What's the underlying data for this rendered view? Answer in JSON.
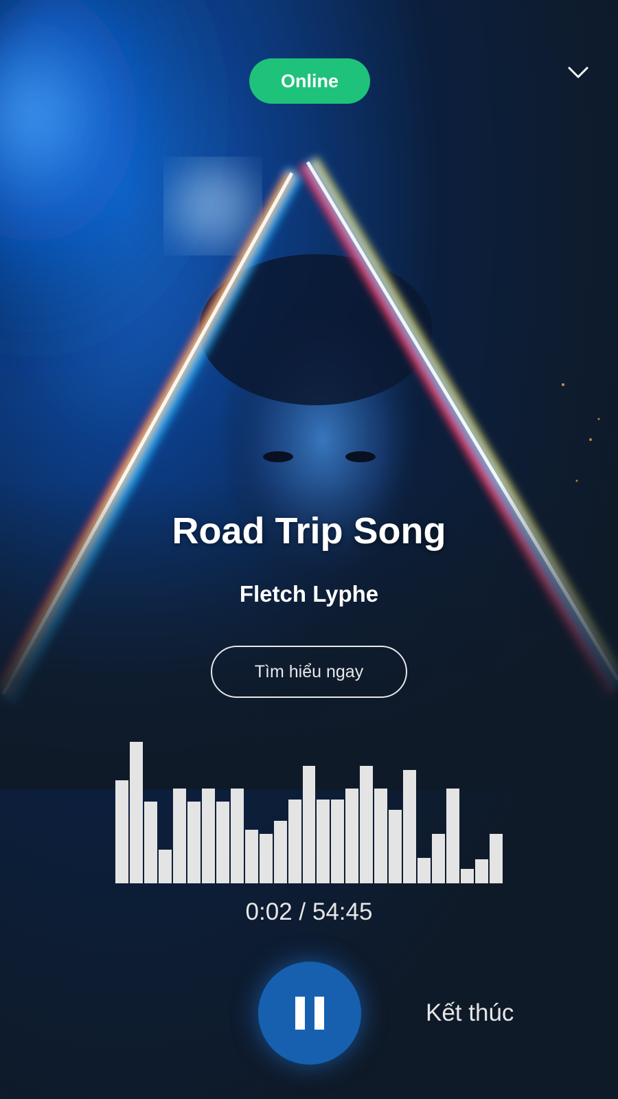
{
  "header": {
    "status_label": "Online",
    "collapse_icon": "chevron-down-icon"
  },
  "track": {
    "title": "Road Trip Song",
    "artist": "Fletch Lyphe",
    "learn_more_label": "Tìm hiểu ngay"
  },
  "player": {
    "current_time": "0:02",
    "total_time": "54:45",
    "time_separator": " / ",
    "pause_icon": "pause-icon",
    "end_label": "Kết thúc",
    "visualizer_levels": [
      0.73,
      1.0,
      0.58,
      0.24,
      0.67,
      0.58,
      0.67,
      0.58,
      0.67,
      0.38,
      0.35,
      0.44,
      0.59,
      0.83,
      0.59,
      0.59,
      0.67,
      0.83,
      0.67,
      0.52,
      0.8,
      0.18,
      0.35,
      0.67,
      0.1,
      0.17,
      0.35
    ]
  },
  "colors": {
    "status_green": "#1ec27a",
    "play_button_blue": "#1760b0",
    "background": "#0f1a28"
  }
}
